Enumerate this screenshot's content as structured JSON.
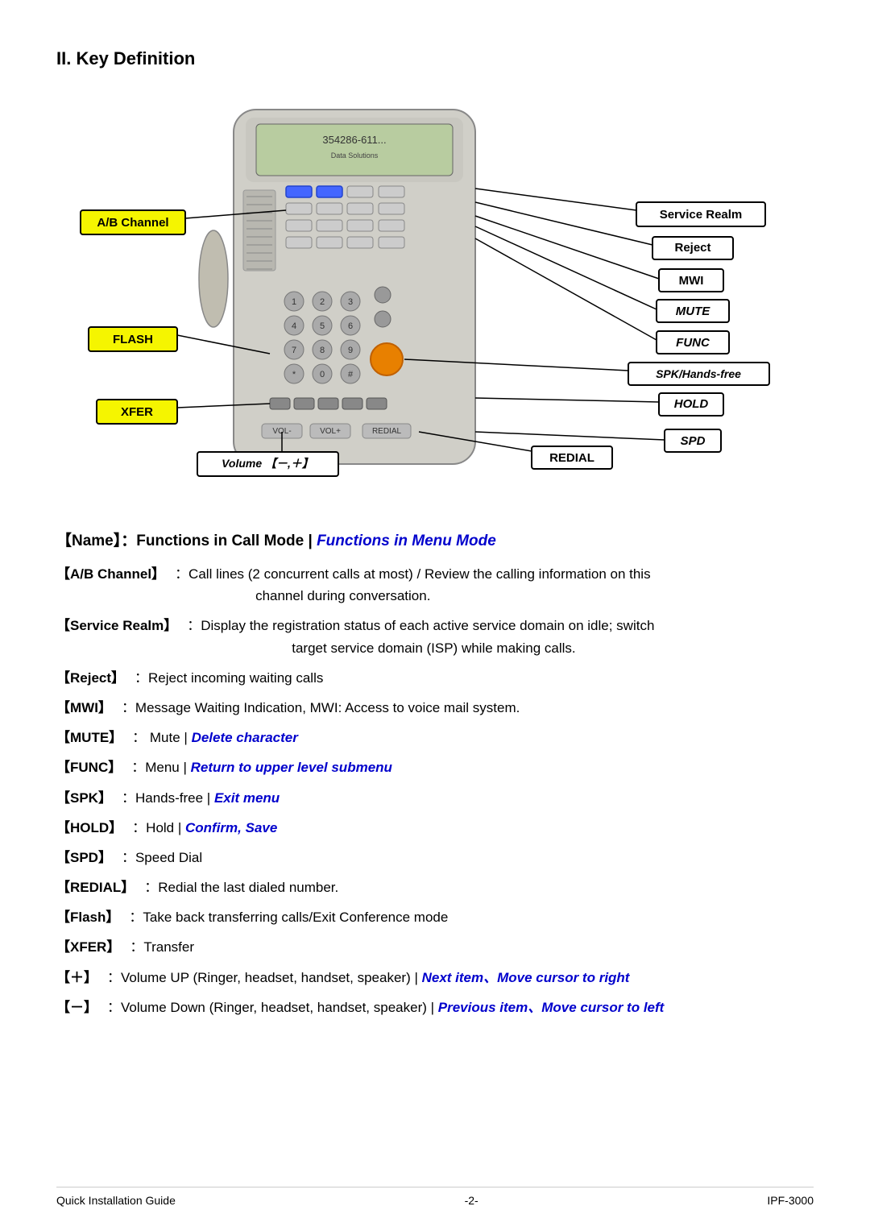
{
  "title": "II.   Key Definition",
  "labels": {
    "ab_channel": "A/B Channel",
    "service_realm": "Service Realm",
    "reject": "Reject",
    "mwi": "MWI",
    "mute": "MUTE",
    "func": "FUNC",
    "spk": "SPK/Hands-free",
    "hold": "HOLD",
    "redial": "REDIAL",
    "spd": "SPD",
    "flash": "FLASH",
    "xfer": "XFER",
    "volume": "Volume 【－,＋】"
  },
  "desc_header": {
    "prefix": "【Name】：Functions in Call Mode | ",
    "italic": "Functions in Menu Mode"
  },
  "descriptions": [
    {
      "key": "【A/B Channel】",
      "text": "：Call lines (2 concurrent calls at most) / Review the calling information on this channel during conversation."
    },
    {
      "key": "【Service Realm】",
      "text": "：Display the registration status of each active service domain on idle; switch target service domain (ISP) while making calls."
    },
    {
      "key": "【Reject】",
      "text": "：Reject incoming waiting calls"
    },
    {
      "key": "【MWI】",
      "text": "：Message Waiting Indication, MWI: Access to voice mail system."
    },
    {
      "key": "【MUTE】",
      "text": "：  Mute | ",
      "italic": "Delete character"
    },
    {
      "key": "【FUNC】",
      "text": "：Menu | ",
      "italic": "Return to upper level submenu"
    },
    {
      "key": "【SPK】",
      "text": "：Hands-free | ",
      "italic": "Exit menu"
    },
    {
      "key": "【HOLD】",
      "text": "：Hold | ",
      "italic": "Confirm, Save"
    },
    {
      "key": "【SPD】",
      "text": "：Speed Dial"
    },
    {
      "key": "【REDIAL】",
      "text": "：Redial the last dialed number."
    },
    {
      "key": "【Flash】",
      "text": "：Take back transferring calls/Exit Conference mode"
    },
    {
      "key": "【XFER】",
      "text": "：Transfer"
    },
    {
      "key": "【＋】",
      "text": "：Volume UP (Ringer, headset, handset, speaker) | ",
      "italic": "Next item、Move cursor to right"
    },
    {
      "key": "【－】",
      "text": "：Volume Down (Ringer, headset, handset, speaker) | ",
      "italic": "Previous item、Move cursor to left"
    }
  ],
  "footer": {
    "left": "Quick Installation Guide",
    "center": "-2-",
    "right": "IPF-3000"
  }
}
